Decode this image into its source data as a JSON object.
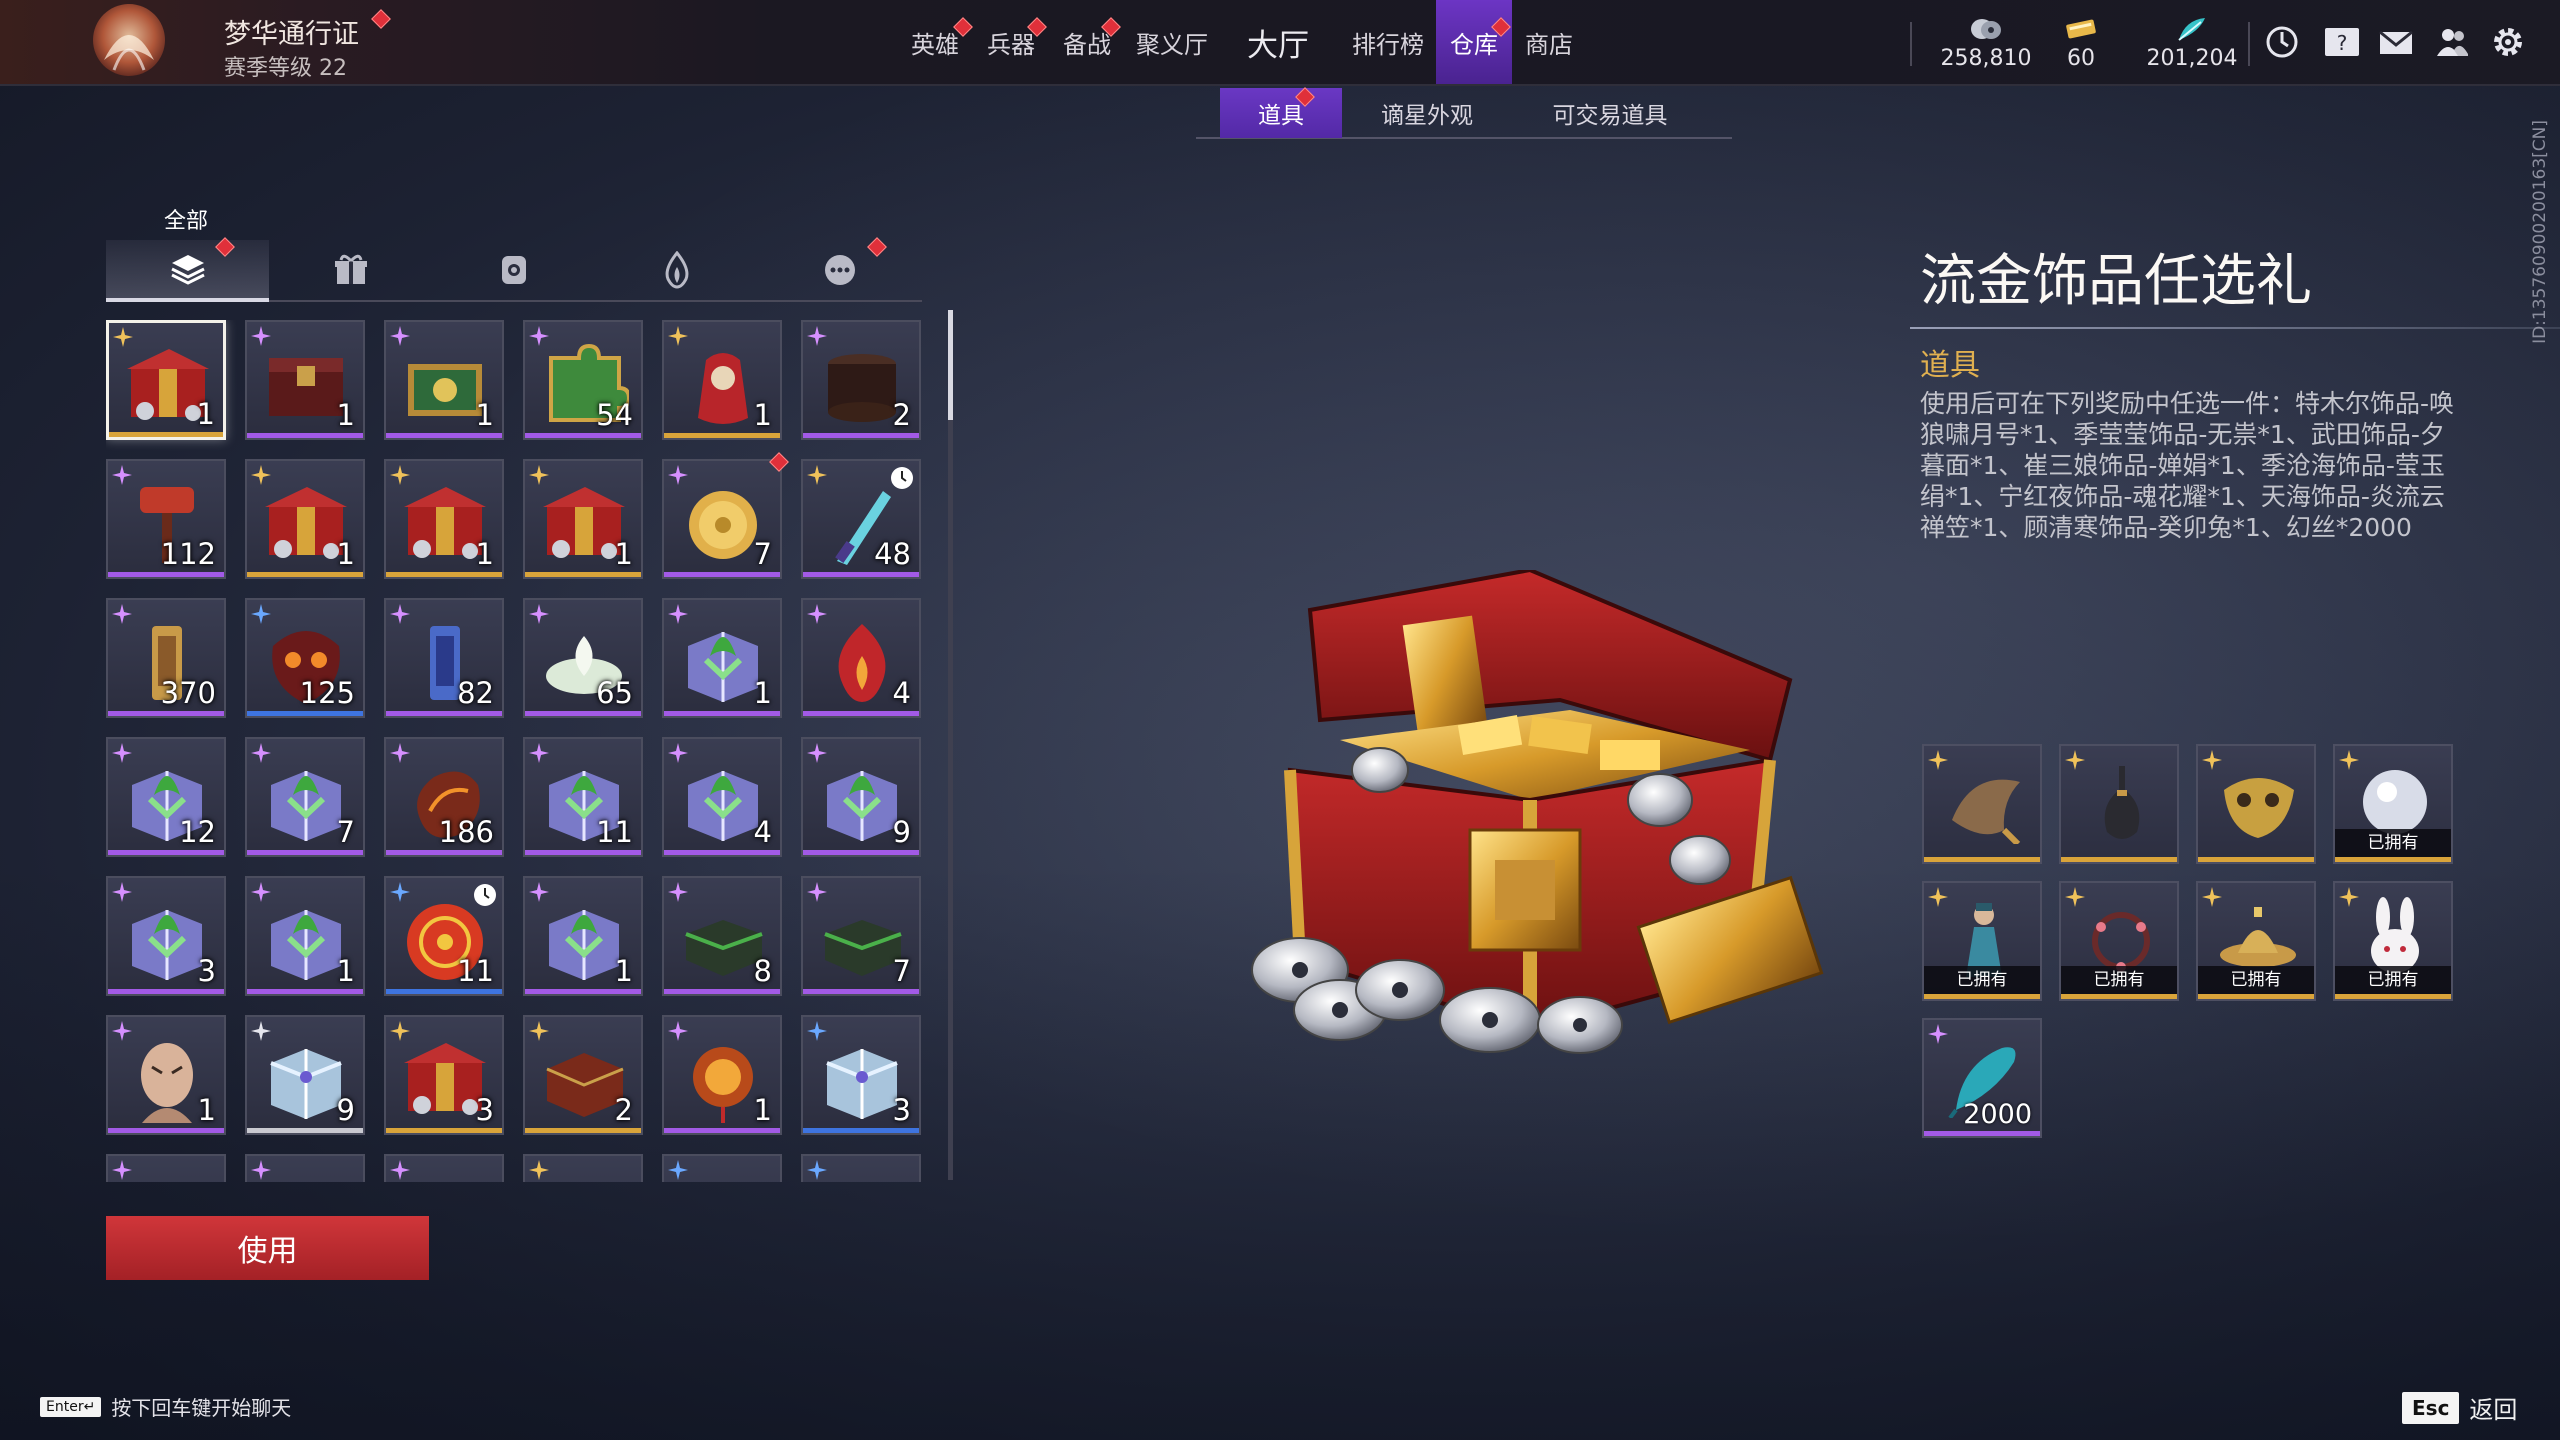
{
  "pass": {
    "title": "梦华通行证",
    "level": "赛季等级 22"
  },
  "nav": [
    {
      "label": "英雄",
      "dot": true
    },
    {
      "label": "兵器",
      "dot": true
    },
    {
      "label": "备战",
      "dot": true
    },
    {
      "label": "聚义厅",
      "dot": false
    },
    {
      "label": "大厅",
      "dot": false
    },
    {
      "label": "排行榜",
      "dot": false
    },
    {
      "label": "仓库",
      "dot": true,
      "active": true
    },
    {
      "label": "商店",
      "dot": false
    }
  ],
  "currencies": [
    {
      "icon": "coin-stack-icon",
      "value": "258,810"
    },
    {
      "icon": "ticket-icon",
      "value": "60"
    },
    {
      "icon": "feather-icon",
      "value": "201,204"
    }
  ],
  "top_icons": [
    "clock-icon",
    "help-book-icon",
    "mail-icon",
    "friends-icon",
    "settings-gear-icon"
  ],
  "subtabs": [
    {
      "label": "道具",
      "active": true,
      "dot": true
    },
    {
      "label": "谪星外观",
      "active": false
    },
    {
      "label": "可交易道具",
      "active": false
    }
  ],
  "category": {
    "label": "全部",
    "tabs": [
      "layers-icon",
      "gift-icon",
      "bag-icon",
      "flame-icon",
      "more-icon"
    ]
  },
  "inventory": [
    {
      "qty": "1",
      "rarity": "gold",
      "corner": "gold",
      "art": "chest-red",
      "selected": true
    },
    {
      "qty": "1",
      "rarity": "purple",
      "corner": "purple",
      "art": "chest-dark"
    },
    {
      "qty": "1",
      "rarity": "purple",
      "corner": "purple",
      "art": "chest-green"
    },
    {
      "qty": "54",
      "rarity": "purple",
      "corner": "purple",
      "art": "puzzle"
    },
    {
      "qty": "1",
      "rarity": "gold",
      "corner": "gold",
      "art": "pouch"
    },
    {
      "qty": "2",
      "rarity": "purple",
      "corner": "purple",
      "art": "jar"
    },
    {
      "qty": "112",
      "rarity": "purple",
      "corner": "purple",
      "art": "hammer"
    },
    {
      "qty": "1",
      "rarity": "gold",
      "corner": "gold",
      "art": "chest-red"
    },
    {
      "qty": "1",
      "rarity": "gold",
      "corner": "gold",
      "art": "chest-red"
    },
    {
      "qty": "1",
      "rarity": "gold",
      "corner": "gold",
      "art": "chest-red"
    },
    {
      "qty": "7",
      "rarity": "purple",
      "corner": "purple",
      "art": "coin",
      "dot": true
    },
    {
      "qty": "48",
      "rarity": "purple",
      "corner": "gold",
      "art": "blade",
      "clock": true
    },
    {
      "qty": "370",
      "rarity": "purple",
      "corner": "purple",
      "art": "token-gold"
    },
    {
      "qty": "125",
      "rarity": "blue",
      "corner": "blue",
      "art": "mask"
    },
    {
      "qty": "82",
      "rarity": "purple",
      "corner": "purple",
      "art": "token-blue"
    },
    {
      "qty": "65",
      "rarity": "purple",
      "corner": "purple",
      "art": "lotus"
    },
    {
      "qty": "1",
      "rarity": "purple",
      "corner": "purple",
      "art": "giftbox"
    },
    {
      "qty": "4",
      "rarity": "purple",
      "corner": "purple",
      "art": "flame"
    },
    {
      "qty": "12",
      "rarity": "purple",
      "corner": "purple",
      "art": "giftbox"
    },
    {
      "qty": "7",
      "rarity": "purple",
      "corner": "purple",
      "art": "giftbox"
    },
    {
      "qty": "186",
      "rarity": "purple",
      "corner": "purple",
      "art": "stone"
    },
    {
      "qty": "11",
      "rarity": "purple",
      "corner": "purple",
      "art": "giftbox"
    },
    {
      "qty": "4",
      "rarity": "purple",
      "corner": "purple",
      "art": "giftbox"
    },
    {
      "qty": "9",
      "rarity": "purple",
      "corner": "purple",
      "art": "giftbox"
    },
    {
      "qty": "3",
      "rarity": "purple",
      "corner": "purple",
      "art": "giftbox"
    },
    {
      "qty": "1",
      "rarity": "purple",
      "corner": "purple",
      "art": "giftbox"
    },
    {
      "qty": "11",
      "rarity": "blue",
      "corner": "blue",
      "art": "ball",
      "clock": true
    },
    {
      "qty": "1",
      "rarity": "purple",
      "corner": "purple",
      "art": "giftbox"
    },
    {
      "qty": "8",
      "rarity": "purple",
      "corner": "purple",
      "art": "case-green"
    },
    {
      "qty": "7",
      "rarity": "purple",
      "corner": "purple",
      "art": "case-green"
    },
    {
      "qty": "1",
      "rarity": "purple",
      "corner": "purple",
      "art": "face"
    },
    {
      "qty": "9",
      "rarity": "white",
      "corner": "white",
      "art": "giftbox-ice"
    },
    {
      "qty": "3",
      "rarity": "gold",
      "corner": "gold",
      "art": "chest-red"
    },
    {
      "qty": "2",
      "rarity": "gold",
      "corner": "gold",
      "art": "box-brown"
    },
    {
      "qty": "1",
      "rarity": "purple",
      "corner": "purple",
      "art": "lantern"
    },
    {
      "qty": "3",
      "rarity": "blue",
      "corner": "blue",
      "art": "giftbox-ice"
    },
    {
      "qty": "",
      "rarity": "purple",
      "corner": "purple",
      "art": "partial"
    },
    {
      "qty": "",
      "rarity": "purple",
      "corner": "purple",
      "art": "partial"
    },
    {
      "qty": "",
      "rarity": "purple",
      "corner": "purple",
      "art": "partial"
    },
    {
      "qty": "",
      "rarity": "gold",
      "corner": "gold",
      "art": "partial"
    },
    {
      "qty": "",
      "rarity": "blue",
      "corner": "blue",
      "art": "partial"
    },
    {
      "qty": "",
      "rarity": "blue",
      "corner": "blue",
      "art": "partial"
    }
  ],
  "use_button": "使用",
  "detail": {
    "title": "流金饰品任选礼",
    "type": "道具",
    "description": "使用后可在下列奖励中任选一件：特木尔饰品-唤狼啸月号*1、季莹莹饰品-无祟*1、武田饰品-夕暮面*1、崔三娘饰品-婵娟*1、季沧海饰品-莹玉绢*1、宁红夜饰品-魂花耀*1、天海饰品-炎流云禅笠*1、顾清寒饰品-癸卯兔*1、幻丝*2000",
    "rewards": [
      {
        "art": "horn",
        "rarity": "gold",
        "owned": ""
      },
      {
        "art": "vase",
        "rarity": "gold",
        "owned": ""
      },
      {
        "art": "golden-mask",
        "rarity": "gold",
        "owned": ""
      },
      {
        "art": "orb",
        "rarity": "gold",
        "owned": "已拥有"
      },
      {
        "art": "figure",
        "rarity": "gold",
        "owned": "已拥有"
      },
      {
        "art": "wreath",
        "rarity": "gold",
        "owned": "已拥有"
      },
      {
        "art": "hat",
        "rarity": "gold",
        "owned": "已拥有"
      },
      {
        "art": "rabbit",
        "rarity": "gold",
        "owned": "已拥有"
      },
      {
        "art": "thread",
        "rarity": "purple",
        "owned": "",
        "qty": "2000"
      }
    ]
  },
  "chat_hint": {
    "key": "Enter↵",
    "text": "按下回车键开始聊天"
  },
  "esc": {
    "key": "Esc",
    "text": "返回"
  },
  "side_id": "ID:135760900200163[CN]",
  "colors": {
    "accent": "#5a2fb0",
    "gold": "#d9a43a",
    "purple": "#a25ae6",
    "blue": "#3e74e0",
    "use_red": "#c02b30"
  }
}
